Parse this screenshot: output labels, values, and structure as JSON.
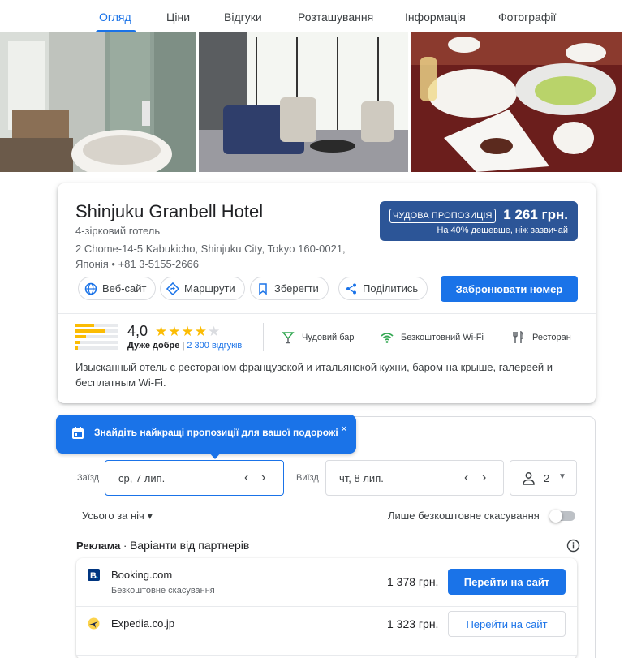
{
  "tabs": [
    {
      "label": "Огляд",
      "active": true
    },
    {
      "label": "Ціни"
    },
    {
      "label": "Відгуки"
    },
    {
      "label": "Розташування"
    },
    {
      "label": "Інформація"
    },
    {
      "label": "Фотографії"
    }
  ],
  "hotel": {
    "name": "Shinjuku Granbell Hotel",
    "class": "4-зірковий готель",
    "address_line1": "2 Chome-14-5 Kabukicho, Shinjuku City, Tokyo 160-0021,",
    "address_line2": "Японія",
    "phone": "+81 3-5155-2666",
    "deal": {
      "badge": "ЧУДОВА ПРОПОЗИЦІЯ",
      "price": "1 261 грн.",
      "note": "На 40% дешевше, ніж зазвичай",
      "color": "#2c5597"
    },
    "actions": {
      "website": "Веб-сайт",
      "directions": "Маршрути",
      "save": "Зберегти",
      "share": "Поділитись",
      "book": "Забронювати номер"
    },
    "rating": {
      "score": "4,0",
      "stars": 4,
      "stars_max": 5,
      "word": "Дуже добре",
      "separator": "|",
      "reviews": "2 300 відгуків",
      "distribution": [
        0.45,
        0.7,
        0.25,
        0.1,
        0.05
      ]
    },
    "amenities": [
      {
        "label": "Чудовий бар",
        "icon": "bar-icon"
      },
      {
        "label": "Безкоштовний Wi-Fi",
        "icon": "wifi-icon"
      },
      {
        "label": "Ресторан",
        "icon": "restaurant-icon"
      }
    ],
    "description": "Изысканный отель с рестораном французской и итальянской кухни, баром на крыше, галереей и бесплатным Wi-Fi."
  },
  "booking": {
    "tip": "Знайдіть найкращі пропозиції для вашої подорожі",
    "tip_close": "×",
    "checkin_label": "Заїзд",
    "checkin_value": "ср, 7 лип.",
    "checkout_label": "Виїзд",
    "checkout_value": "чт, 8 лип.",
    "nav_prev": "‹",
    "nav_next": "›",
    "guests": "2",
    "guests_caret": "▼",
    "total_select": "Усього за ніч ▾",
    "free_cancel_label": "Лише безкоштовне скасування",
    "free_cancel_on": false,
    "ads_label": "Реклама",
    "ads_dot": " · ",
    "ads_title": "Варіанти від партнерів"
  },
  "offers": [
    {
      "partner": "Booking.com",
      "sub": "Безкоштовне скасування",
      "price": "1 378 грн.",
      "button": "Перейти на сайт",
      "primary": true,
      "logo": "booking-logo-icon"
    },
    {
      "partner": "Expedia.co.jp",
      "sub": "",
      "price": "1 323 грн.",
      "button": "Перейти на сайт",
      "primary": false,
      "logo": "expedia-logo-icon"
    }
  ],
  "colors": {
    "accent": "#1a73e8",
    "star": "#fbbc04",
    "deal": "#2c5597"
  }
}
